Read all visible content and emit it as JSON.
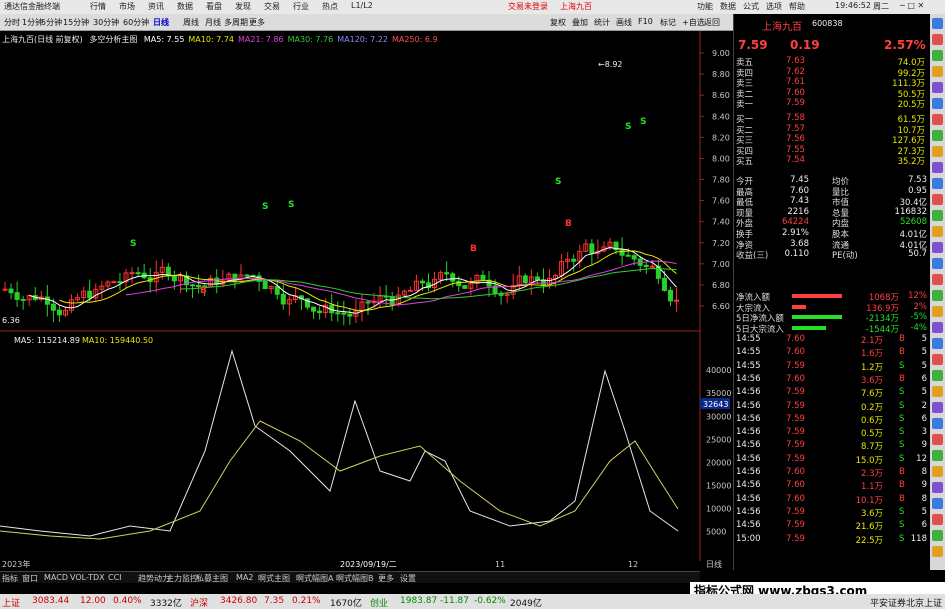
{
  "window": {
    "app_title": "通达信金融终端",
    "center_text": "交易未登录",
    "stock_title": "上海九百",
    "time": "19:46:52",
    "weekday": "周二"
  },
  "toolbar": {
    "items": [
      "分时",
      "1分钟",
      "5分钟",
      "15分钟",
      "30分钟",
      "60分钟",
      "日线",
      "周线",
      "月线",
      "多周期",
      "更多"
    ],
    "menus": [
      "行情",
      "市场",
      "资讯",
      "数据",
      "看盘",
      "发现",
      "交易",
      "行业",
      "热点",
      "L1/L2"
    ],
    "right_buttons": [
      "复权",
      "叠加",
      "统计",
      "画线",
      "F10",
      "标记",
      "+自选",
      "返回"
    ],
    "util": [
      "功能",
      "数据",
      "公式",
      "选项",
      "帮助"
    ]
  },
  "chart": {
    "title": "上海九百(日线 前复权)",
    "strategy": "多空分析主图",
    "ma_labels": [
      {
        "t": "MA5: 7.55",
        "c": "#ffffff"
      },
      {
        "t": "MA10: 7.74",
        "c": "#e8e800"
      },
      {
        "t": "MA21: 7.86",
        "c": "#e040e0"
      },
      {
        "t": "MA30: 7.76",
        "c": "#33cc33"
      },
      {
        "t": "MA120: 7.22",
        "c": "#8888ff"
      },
      {
        "t": "MA250: 6.9",
        "c": "#ff5050"
      }
    ],
    "y_ticks": [
      "9.00",
      "8.80",
      "8.60",
      "8.40",
      "8.20",
      "8.00",
      "7.80",
      "7.60",
      "7.40",
      "7.20",
      "7.00",
      "6.80",
      "6.60"
    ],
    "high_label": "8.92",
    "low_label": "6.36",
    "vol_labels": {
      "ma5": "MA5: 115214.89",
      "ma10": "MA10: 159440.50"
    },
    "vol_ticks": [
      "40000",
      "35000",
      "30000",
      "25000",
      "20000",
      "15000",
      "10000",
      "5000"
    ],
    "vol_marker": "32643",
    "x_labels": [
      "2023年",
      "2023/09/19/二",
      "11",
      "12"
    ],
    "unit": "日线"
  },
  "quote": {
    "name": "上海九百",
    "code": "600838",
    "price": "7.59",
    "change": "0.19",
    "pct": "2.57%",
    "asks": [
      [
        "卖五",
        "7.63",
        "74.0万"
      ],
      [
        "卖四",
        "7.62",
        "99.2万"
      ],
      [
        "卖三",
        "7.61",
        "111.3万"
      ],
      [
        "卖二",
        "7.60",
        "50.5万"
      ],
      [
        "卖一",
        "7.59",
        "20.5万"
      ]
    ],
    "bids": [
      [
        "买一",
        "7.58",
        "61.5万"
      ],
      [
        "买二",
        "7.57",
        "10.7万"
      ],
      [
        "买三",
        "7.56",
        "127.6万"
      ],
      [
        "买四",
        "7.55",
        "27.3万"
      ],
      [
        "买五",
        "7.54",
        "35.2万"
      ]
    ],
    "stats": [
      [
        "今开",
        "7.45",
        "均价",
        "7.53"
      ],
      [
        "最高",
        "7.60",
        "量比",
        "0.95"
      ],
      [
        "最低",
        "7.43",
        "市值",
        "30.4亿"
      ],
      [
        "现量",
        "2216",
        "总量",
        "116832"
      ],
      [
        "外盘",
        "64224",
        "内盘",
        "52608"
      ],
      [
        "换手",
        "2.91%",
        "股本",
        "4.01亿"
      ],
      [
        "净资",
        "3.68",
        "流通",
        "4.01亿"
      ],
      [
        "收益(三)",
        "0.110",
        "PE(动)",
        "50.7"
      ]
    ],
    "flows": [
      [
        "净流入额",
        "1068万",
        "12%"
      ],
      [
        "大宗流入",
        "136.9万",
        "2%"
      ],
      [
        "5日净流入额",
        "-2134万",
        "-5%"
      ],
      [
        "5日大宗流入",
        "-1544万",
        "-4%"
      ]
    ],
    "ticks": [
      [
        "14:55",
        "7.60",
        "2.1万",
        "B",
        "5"
      ],
      [
        "14:55",
        "7.60",
        "1.6万",
        "B",
        "5"
      ],
      [
        "14:55",
        "7.59",
        "1.2万",
        "S",
        "5"
      ],
      [
        "14:56",
        "7.60",
        "3.6万",
        "B",
        "6"
      ],
      [
        "14:56",
        "7.59",
        "7.6万",
        "S",
        "5"
      ],
      [
        "14:56",
        "7.59",
        "0.2万",
        "S",
        "2"
      ],
      [
        "14:56",
        "7.59",
        "0.6万",
        "S",
        "6"
      ],
      [
        "14:56",
        "7.59",
        "0.5万",
        "S",
        "3"
      ],
      [
        "14:56",
        "7.59",
        "8.7万",
        "S",
        "9"
      ],
      [
        "14:56",
        "7.59",
        "15.0万",
        "S",
        "12"
      ],
      [
        "14:56",
        "7.60",
        "2.3万",
        "B",
        "8"
      ],
      [
        "14:56",
        "7.60",
        "1.1万",
        "B",
        "9"
      ],
      [
        "14:56",
        "7.60",
        "10.1万",
        "B",
        "8"
      ],
      [
        "14:56",
        "7.59",
        "3.6万",
        "S",
        "5"
      ],
      [
        "14:56",
        "7.59",
        "21.6万",
        "S",
        "6"
      ],
      [
        "15:00",
        "7.59",
        "22.5万",
        "S",
        "118"
      ]
    ]
  },
  "tabs": [
    "指标",
    "窗口",
    "MACD",
    "VOL-TDX",
    "CCI",
    "趋势动力",
    "主力监控",
    "私募主图",
    "MA2",
    "啊式主图",
    "啊式幅图A",
    "啊式幅图B",
    "更多",
    "设置"
  ],
  "status": {
    "idx1": "上证",
    "v1": "3083.44",
    "c1": "12.00",
    "p1": "0.40%",
    "a1": "3332亿",
    "idx2": "沪深",
    "v2": "3426.80",
    "c2": "7.35",
    "p2": "0.21%",
    "a2": "1670亿",
    "idx3": "创业",
    "v3": "1983.87",
    "c3": "-11.87",
    "p3": "-0.62%",
    "a3": "2049亿",
    "marquee": "平安证券北京上证"
  },
  "watermark": "指标公式网 www.zbgs3.com"
}
